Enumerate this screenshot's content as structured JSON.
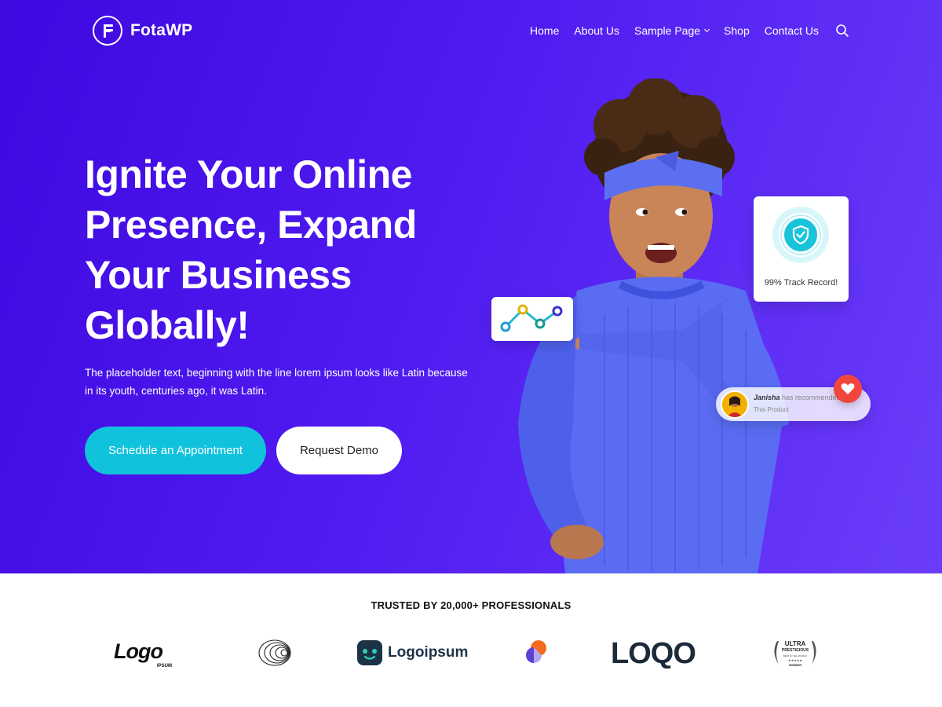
{
  "header": {
    "logo_text": "FotaWP",
    "logo_icon": "f-circle-logo",
    "nav": [
      {
        "label": "Home"
      },
      {
        "label": "About Us"
      },
      {
        "label": "Sample Page",
        "has_dropdown": true
      },
      {
        "label": "Shop"
      },
      {
        "label": "Contact Us"
      }
    ],
    "search_icon": "search-icon"
  },
  "hero": {
    "headline": "Ignite Your Online Presence, Expand Your Business Globally!",
    "subtext": "The placeholder text, beginning with the line lorem ipsum looks like Latin because in its youth, centuries ago, it was Latin.",
    "primary_button": "Schedule an Appointment",
    "secondary_button": "Request Demo"
  },
  "cards": {
    "track_record": "99% Track Record!",
    "recommend_name": "Janisha",
    "recommend_text": "has recommended",
    "recommend_product": "This Product"
  },
  "trusted": {
    "title": "TRUSTED BY 20,000+ PROFESSIONALS",
    "logos": [
      {
        "text": "Logo",
        "sub": "IPSUM"
      },
      {
        "text": ""
      },
      {
        "text": "Logoipsum"
      },
      {
        "text": ""
      },
      {
        "text": "LOQO"
      },
      {
        "text": "ULTRA",
        "sub": "PRESTIGIOUS",
        "sub2": "BEST IN THE WORLD",
        "sub3": "WINNER"
      }
    ]
  },
  "colors": {
    "hero_bg": "#4f1bf0",
    "accent_cyan": "#11c2dd",
    "sweater": "#5a6cf2",
    "heart": "#f2453d"
  }
}
